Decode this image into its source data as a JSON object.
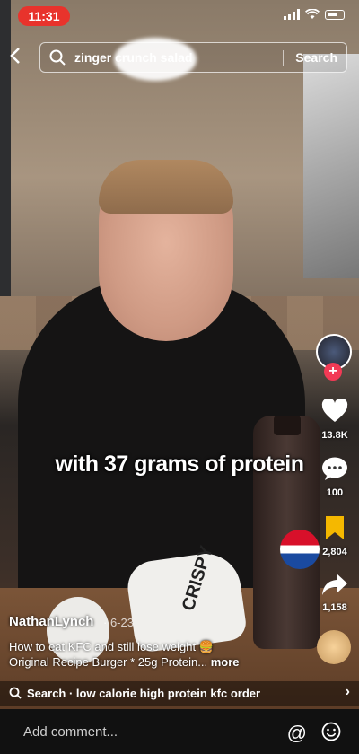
{
  "status_bar": {
    "time": "11:31"
  },
  "search": {
    "query": "zinger crunch salad",
    "button_label": "Search"
  },
  "video": {
    "overlay_caption": "with 37 grams of protein",
    "author": "NathanLynch",
    "date": "· 6-23",
    "description_line1": "How to eat KFC and still lose weight 🍔",
    "description_line2": "Original Recipe Burger * 25g Protein...",
    "more_label": "more",
    "in_scene_text": {
      "wrapper_label": "CRISPY",
      "bottle_label": "PEPSI"
    }
  },
  "actions": {
    "likes": "13.8K",
    "comments": "100",
    "saves": "2,804",
    "shares": "1,158"
  },
  "related_search": {
    "label": "Search · low calorie high protein kfc order"
  },
  "comment_bar": {
    "placeholder": "Add comment..."
  },
  "colors": {
    "status_time_bg": "#e8332c",
    "follow_badge": "#f23a55",
    "save_icon": "#f5b800"
  }
}
